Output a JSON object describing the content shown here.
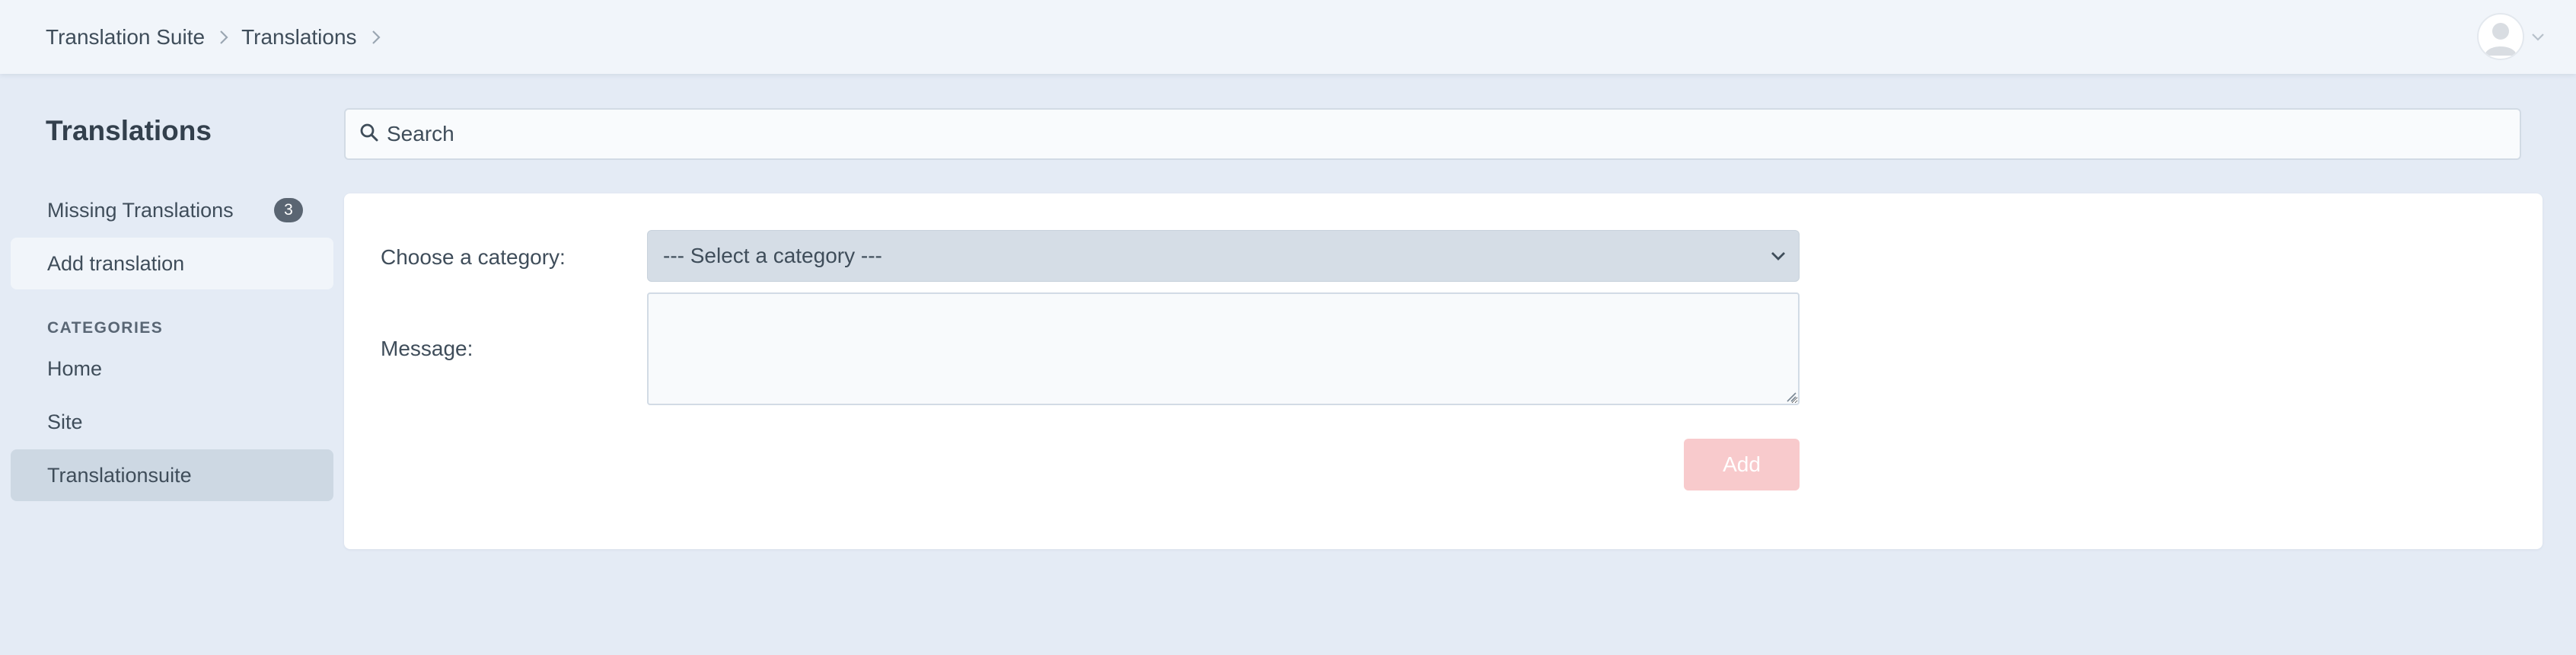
{
  "breadcrumb": [
    {
      "label": "Translation Suite"
    },
    {
      "label": "Translations"
    }
  ],
  "user_menu": {
    "avatar_icon": "user-avatar-icon",
    "caret_icon": "chevron-down-icon"
  },
  "sidebar": {
    "title": "Translations",
    "items": [
      {
        "label": "Missing Translations",
        "badge": "3"
      },
      {
        "label": "Add translation"
      }
    ],
    "categories_heading": "Categories",
    "categories": [
      {
        "label": "Home"
      },
      {
        "label": "Site"
      },
      {
        "label": "Translationsuite"
      }
    ]
  },
  "search": {
    "placeholder": "Search",
    "value": "",
    "icon": "search-icon"
  },
  "form": {
    "category_label": "Choose a category:",
    "category_selected": "--- Select a category ---",
    "message_label": "Message:",
    "message_value": "",
    "add_label": "Add"
  },
  "colors": {
    "page_background": "#e4ebf5",
    "topbar_background": "#f1f5fa",
    "active_item_background": "#cdd8e3",
    "badge_background": "#5a6572",
    "add_button_disabled": "#f8cacc"
  }
}
